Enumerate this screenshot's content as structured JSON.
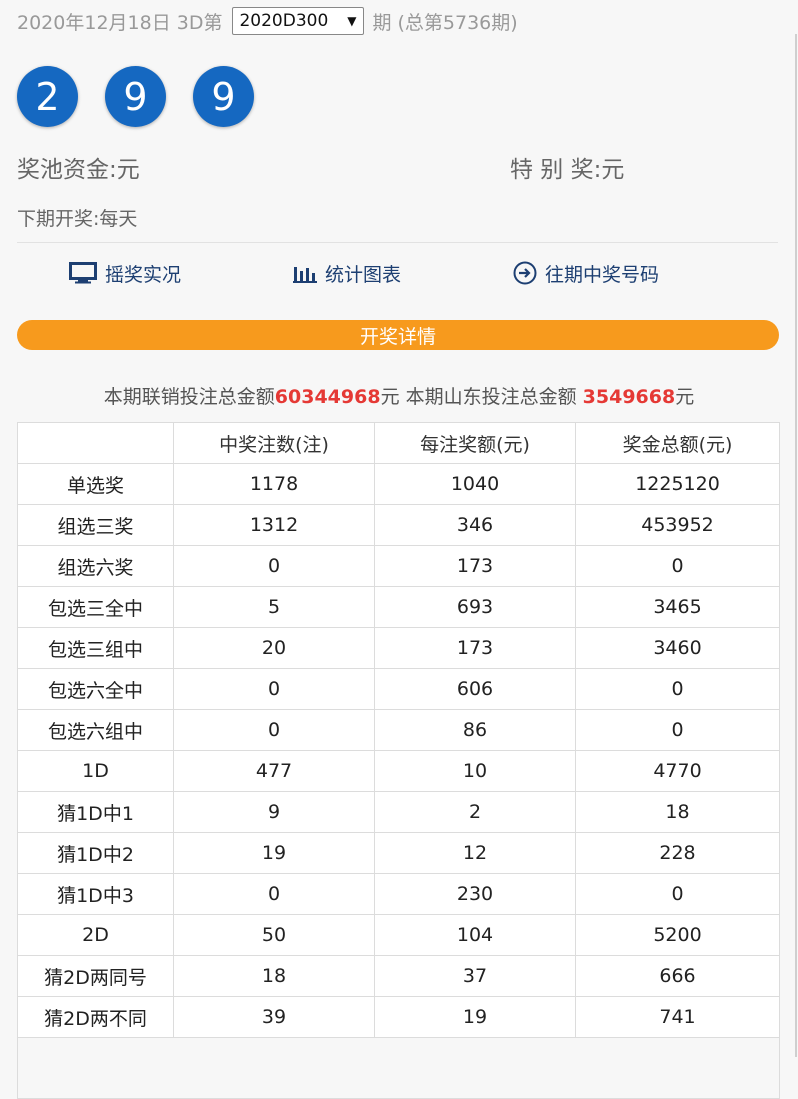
{
  "header": {
    "date_prefix": "2020年12月18日 3D第",
    "issue_selected": "2020D300",
    "issue_suffix": "期 (总第5736期)"
  },
  "balls": [
    "2",
    "9",
    "9"
  ],
  "pool": {
    "jackpot_label": "奖池资金:",
    "jackpot_value": "元",
    "special_label": "特 别 奖:",
    "special_value": "元"
  },
  "next_draw": "下期开奖:每天",
  "nav": {
    "live": "摇奖实况",
    "charts": "统计图表",
    "history": "往期中奖号码"
  },
  "detail_title": "开奖详情",
  "totals": {
    "joint_label": "本期联销投注总金额",
    "joint_amount": "60344968",
    "yuan1": "元 本期山东投注总金额 ",
    "sd_amount": "3549668",
    "yuan2": "元"
  },
  "table": {
    "headers": [
      "",
      "中奖注数(注)",
      "每注奖额(元)",
      "奖金总额(元)"
    ],
    "rows": [
      [
        "单选奖",
        "1178",
        "1040",
        "1225120"
      ],
      [
        "组选三奖",
        "1312",
        "346",
        "453952"
      ],
      [
        "组选六奖",
        "0",
        "173",
        "0"
      ],
      [
        "包选三全中",
        "5",
        "693",
        "3465"
      ],
      [
        "包选三组中",
        "20",
        "173",
        "3460"
      ],
      [
        "包选六全中",
        "0",
        "606",
        "0"
      ],
      [
        "包选六组中",
        "0",
        "86",
        "0"
      ],
      [
        "1D",
        "477",
        "10",
        "4770"
      ],
      [
        "猜1D中1",
        "9",
        "2",
        "18"
      ],
      [
        "猜1D中2",
        "19",
        "12",
        "228"
      ],
      [
        "猜1D中3",
        "0",
        "230",
        "0"
      ],
      [
        "2D",
        "50",
        "104",
        "5200"
      ],
      [
        "猜2D两同号",
        "18",
        "37",
        "666"
      ],
      [
        "猜2D两不同",
        "39",
        "19",
        "741"
      ]
    ]
  },
  "colors": {
    "ball": "#1568c1",
    "detail_bar": "#f79a1d",
    "amount_red": "#e53935",
    "nav_text": "#1d3f72"
  }
}
